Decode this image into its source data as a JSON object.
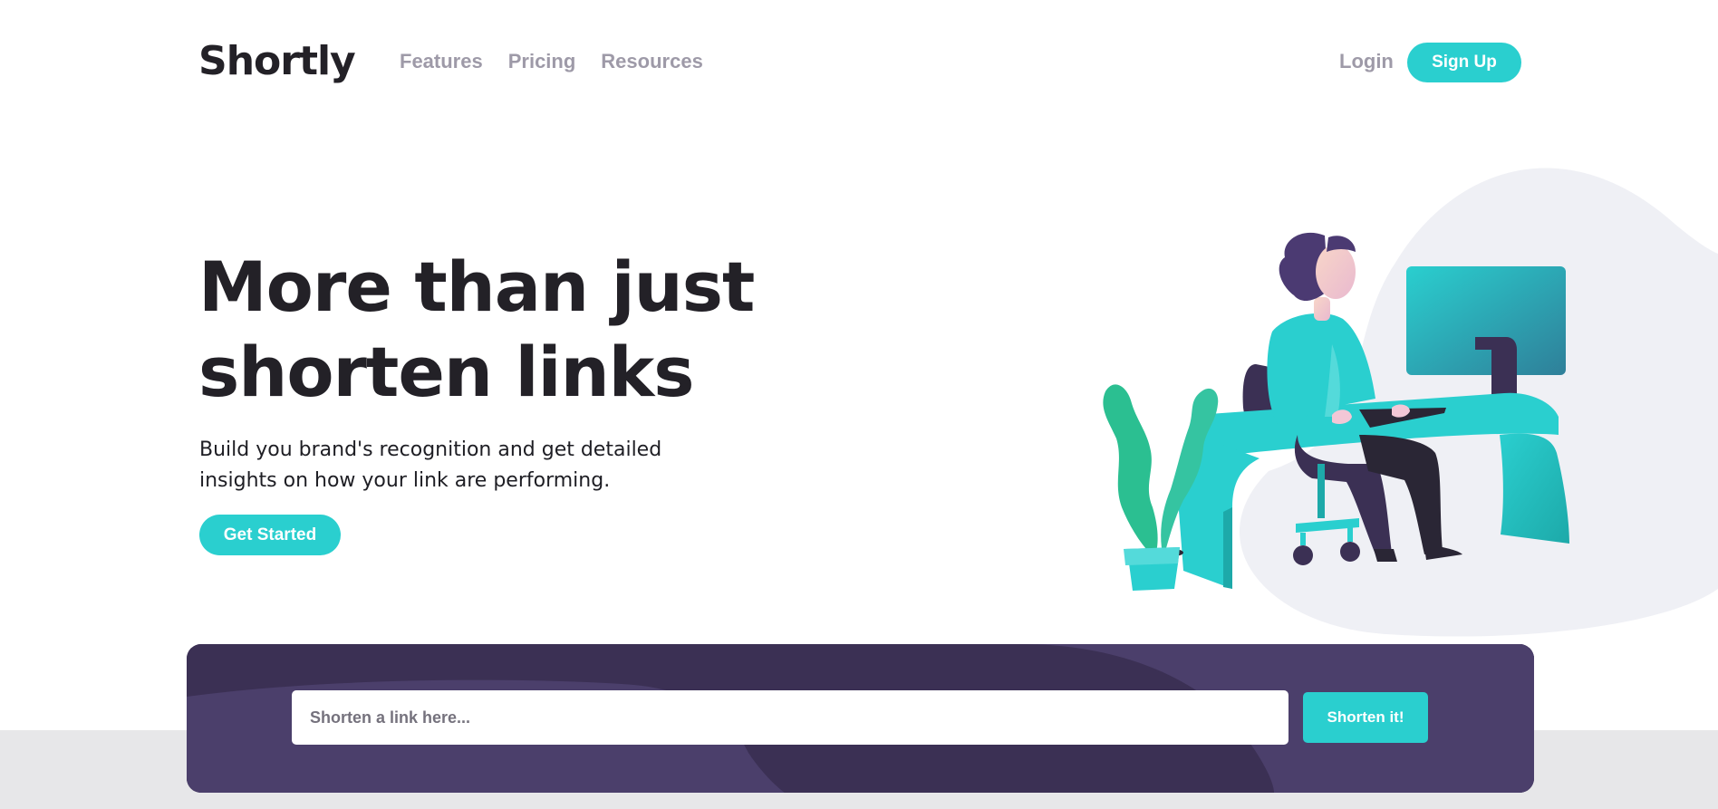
{
  "header": {
    "logo": "Shortly",
    "nav": [
      {
        "label": "Features"
      },
      {
        "label": "Pricing"
      },
      {
        "label": "Resources"
      }
    ],
    "login_label": "Login",
    "signup_label": "Sign Up"
  },
  "hero": {
    "title_line1": "More than just",
    "title_line2": "shorten links",
    "subtitle_line1": "Build you brand's recognition and get detailed",
    "subtitle_line2": "insights on how your link are performing.",
    "cta_label": "Get Started",
    "illustration": "person-working-at-desk-illustration"
  },
  "shorten": {
    "input_value": "",
    "input_placeholder": "Shorten a link here...",
    "button_label": "Shorten it!"
  },
  "colors": {
    "accent": "#2acfcf",
    "dark_violet": "#3b3054",
    "gray_text": "#9e9aa8",
    "heading": "#232127",
    "band": "#e7e7e9"
  }
}
